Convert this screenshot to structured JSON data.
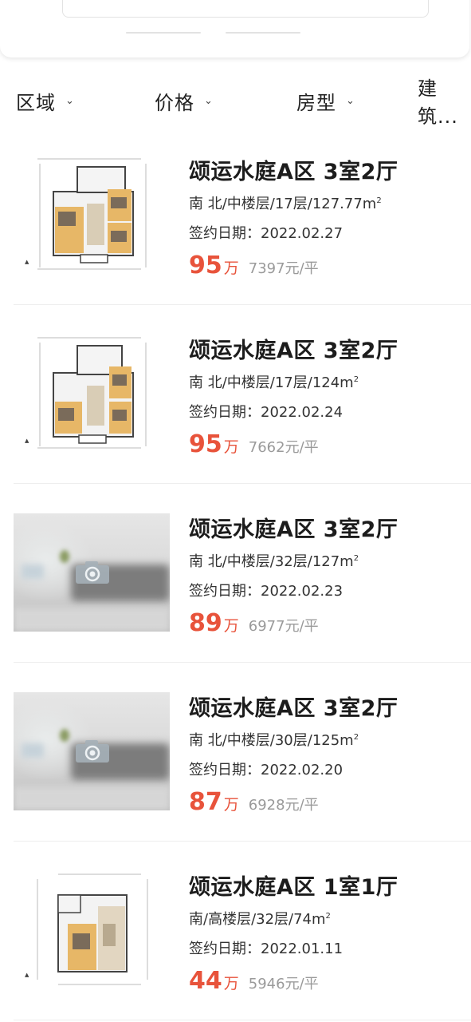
{
  "filters": [
    {
      "label": "区域",
      "icon": "chevron-down-icon"
    },
    {
      "label": "价格",
      "icon": "chevron-down-icon"
    },
    {
      "label": "房型",
      "icon": "chevron-down-icon"
    },
    {
      "label": "建筑..."
    }
  ],
  "listings": [
    {
      "title": "颂运水庭A区 3室2厅",
      "meta": "南 北/中楼层/17层/127.77m",
      "sup": "2",
      "date": "签约日期：2022.02.27",
      "price": "95",
      "price_unit": "万",
      "unit_price": "7397元/平",
      "image": "floor-plan"
    },
    {
      "title": "颂运水庭A区 3室2厅",
      "meta": "南 北/中楼层/17层/124m",
      "sup": "2",
      "date": "签约日期：2022.02.24",
      "price": "95",
      "price_unit": "万",
      "unit_price": "7662元/平",
      "image": "floor-plan"
    },
    {
      "title": "颂运水庭A区 3室2厅",
      "meta": "南 北/中楼层/32层/127m",
      "sup": "2",
      "date": "签约日期：2022.02.23",
      "price": "89",
      "price_unit": "万",
      "unit_price": "6977元/平",
      "image": "placeholder-photo"
    },
    {
      "title": "颂运水庭A区 3室2厅",
      "meta": "南 北/中楼层/30层/125m",
      "sup": "2",
      "date": "签约日期：2022.02.20",
      "price": "87",
      "price_unit": "万",
      "unit_price": "6928元/平",
      "image": "placeholder-photo"
    },
    {
      "title": "颂运水庭A区 1室1厅",
      "meta": "南/高楼层/32层/74m",
      "sup": "2",
      "date": "签约日期：2022.01.11",
      "price": "44",
      "price_unit": "万",
      "unit_price": "5946元/平",
      "image": "floor-plan"
    }
  ],
  "colors": {
    "price": "#e8533b",
    "unit_price": "#9a9a9a",
    "title": "#1c1c1c"
  }
}
